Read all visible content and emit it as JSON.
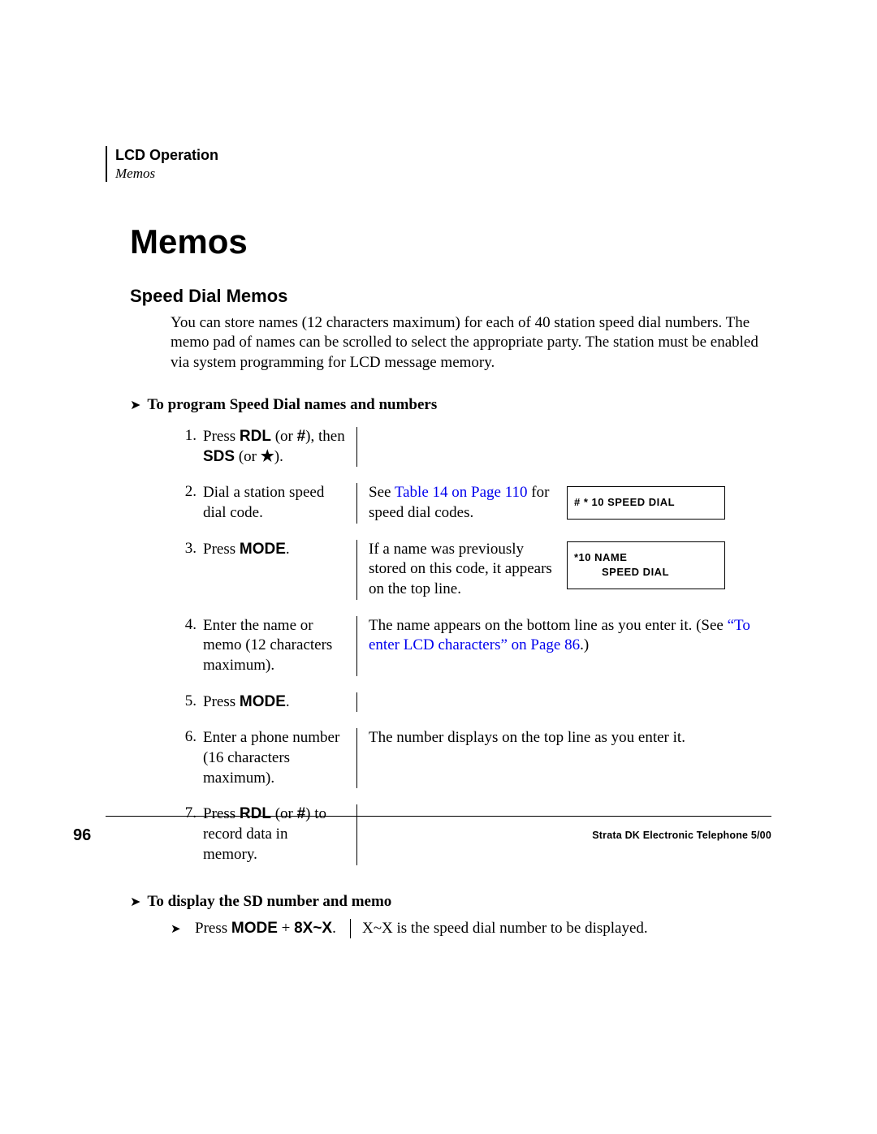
{
  "header": {
    "section": "LCD Operation",
    "subsection": "Memos"
  },
  "h1": "Memos",
  "h2": "Speed Dial Memos",
  "intro": "You can store names (12 characters maximum) for each of 40 station speed dial numbers. The memo pad of names can be scrolled to select the appropriate party. The station must be enabled via system programming for LCD message memory.",
  "proc1_title": "To program Speed Dial names and numbers",
  "steps": [
    {
      "num": "1.",
      "left_pre": "Press ",
      "left_key1": "RDL",
      "left_mid1": " (or ",
      "left_key2": "#",
      "left_mid2": "), then ",
      "left_key3": "SDS",
      "left_mid3": " (or ",
      "left_key4": "★",
      "left_post": ")."
    },
    {
      "num": "2.",
      "left_plain": "Dial a station speed dial code.",
      "right_pre": "See ",
      "right_link": "Table 14 on Page 110",
      "right_post": " for speed dial codes.",
      "lcd": {
        "line1": "# * 10 SPEED DIAL"
      }
    },
    {
      "num": "3.",
      "left_pre": "Press ",
      "left_key1": "MODE",
      "left_post": ".",
      "right_plain": "If a name was previously stored on this code, it appears on the top line.",
      "lcd": {
        "line1": "*10 NAME",
        "line2": "SPEED DIAL"
      }
    },
    {
      "num": "4.",
      "left_plain": "Enter the name or memo (12 characters maximum).",
      "right_pre": "The name appears on the bottom line as you enter it. (See ",
      "right_link": "“To enter LCD characters” on Page 86",
      "right_post": ".)"
    },
    {
      "num": "5.",
      "left_pre": "Press ",
      "left_key1": "MODE",
      "left_post": "."
    },
    {
      "num": "6.",
      "left_plain": "Enter a phone number (16 characters maximum).",
      "right_plain": "The number displays on the top line as you enter it."
    },
    {
      "num": "7.",
      "left_pre": "Press ",
      "left_key1": "RDL",
      "left_mid1": " (or ",
      "left_key2": "#",
      "left_post": ") to record data in memory."
    }
  ],
  "proc2_title": "To display the SD number and memo",
  "display": {
    "left_pre": "Press ",
    "left_key1": "MODE",
    "left_mid1": " + ",
    "left_key2": "8X~X",
    "left_post": ".",
    "right_plain": "X~X is the speed dial number to be displayed."
  },
  "footer": {
    "page": "96",
    "text": "Strata DK Electronic Telephone  5/00"
  }
}
